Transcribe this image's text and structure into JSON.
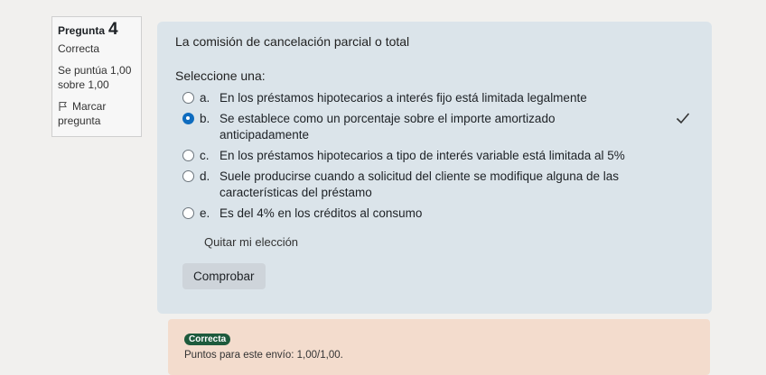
{
  "info": {
    "question_label": "Pregunta",
    "question_number": "4",
    "state": "Correcta",
    "grade_line1": "Se puntúa 1,00",
    "grade_line2": "sobre 1,00",
    "flag_line1": "Marcar",
    "flag_line2": "pregunta"
  },
  "question": {
    "text": "La comisión de cancelación parcial o total",
    "prompt": "Seleccione una:",
    "answers": [
      {
        "letter": "a.",
        "text": "En los préstamos hipotecarios a interés fijo está limitada legalmente",
        "selected": false
      },
      {
        "letter": "b.",
        "text": "Se establece como un porcentaje sobre el importe amortizado anticipadamente",
        "selected": true,
        "correct": true
      },
      {
        "letter": "c.",
        "text": "En los préstamos hipotecarios a tipo de interés variable está limitada al 5%",
        "selected": false
      },
      {
        "letter": "d.",
        "text": "Suele producirse cuando a solicitud del cliente se modifique alguna de las características del préstamo",
        "selected": false
      },
      {
        "letter": "e.",
        "text": "Es del 4% en los créditos al consumo",
        "selected": false
      }
    ],
    "clear_choice": "Quitar mi elección",
    "check_button": "Comprobar"
  },
  "feedback": {
    "badge": "Correcta",
    "points": "Puntos para este envío: 1,00/1,00."
  },
  "colors": {
    "accent": "#0f6cbf",
    "formulation_bg": "#dbe4ea",
    "outcome_bg": "#f3dccd",
    "badge_bg": "#1d5a3c"
  }
}
